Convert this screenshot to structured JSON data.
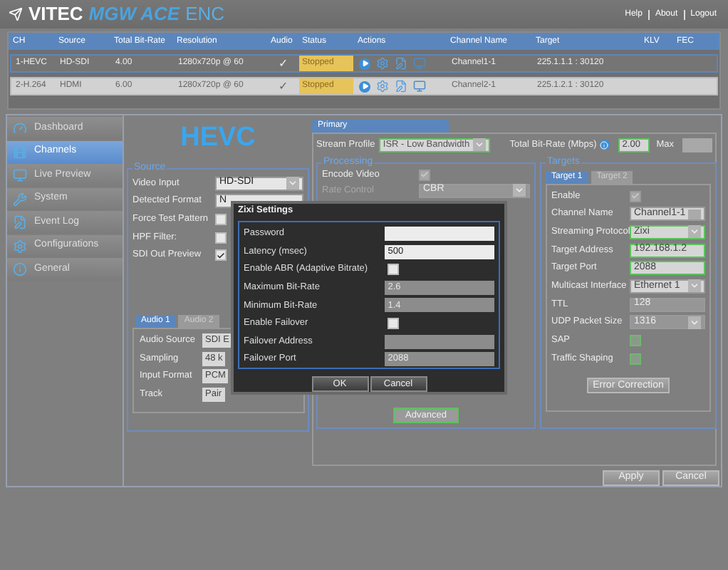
{
  "header": {
    "brand": "VITEC",
    "product": "MGW ACE",
    "suffix": "ENC",
    "links": [
      "Help",
      "About",
      "Logout"
    ]
  },
  "table": {
    "columns": [
      "CH",
      "Source",
      "Total Bit-Rate",
      "Resolution",
      "Audio",
      "Status",
      "Actions",
      "Channel Name",
      "Target",
      "KLV",
      "FEC"
    ],
    "rows": [
      {
        "selected": true,
        "ch": "1-HEVC",
        "source": "HD-SDI",
        "bitrate": "4.00",
        "resolution": "1280x720p @ 60",
        "audio": "✓",
        "status": "Stopped",
        "channel_name": "Channel1-1",
        "target": "225.1.1.1 : 30120"
      },
      {
        "selected": false,
        "ch": "2-H.264",
        "source": "HDMI",
        "bitrate": "6.00",
        "resolution": "1280x720p @ 60",
        "audio": "✓",
        "status": "Stopped",
        "channel_name": "Channel2-1",
        "target": "225.1.2.1 : 30120"
      }
    ]
  },
  "sidebar": {
    "items": [
      {
        "label": "Dashboard",
        "selected": false
      },
      {
        "label": "Channels",
        "selected": true
      },
      {
        "label": "Live Preview",
        "selected": false
      },
      {
        "label": "System",
        "selected": false
      },
      {
        "label": "Event Log",
        "selected": false
      },
      {
        "label": "Configurations",
        "selected": false
      },
      {
        "label": "General",
        "selected": false
      }
    ]
  },
  "page_title": "HEVC",
  "source": {
    "legend": "Source",
    "fields": [
      {
        "label": "Video Input",
        "kind": "select",
        "value": "HD-SDI"
      },
      {
        "label": "Detected Format",
        "kind": "text",
        "value": "N"
      },
      {
        "label": "Force Test Pattern",
        "kind": "checkbox",
        "checked": false
      },
      {
        "label": "HPF Filter:",
        "kind": "checkbox",
        "checked": false
      },
      {
        "label": "SDI Out Preview",
        "kind": "checkbox",
        "checked": true
      }
    ],
    "audio_tabs": [
      {
        "label": "Audio 1",
        "selected": true
      },
      {
        "label": "Audio 2",
        "selected": false
      }
    ],
    "audio_fields": [
      {
        "label": "Audio Source",
        "value": "SDI E"
      },
      {
        "label": "Sampling",
        "value": "48 k"
      },
      {
        "label": "Input Format",
        "value": "PCM"
      },
      {
        "label": "Track",
        "value": "Pair"
      }
    ]
  },
  "primary": {
    "tab": "Primary",
    "stream_profile": {
      "label": "Stream Profile",
      "value": "ISR - Low Bandwidth"
    },
    "total_bitrate": {
      "label": "Total Bit-Rate (Mbps)",
      "value": "2.00"
    },
    "max_label": "Max",
    "processing": {
      "legend": "Processing",
      "fields": [
        {
          "label": "Encode Video",
          "kind": "checkbox",
          "checked": true,
          "disabled": true
        },
        {
          "label": "Rate Control",
          "kind": "select",
          "value": "CBR",
          "disabled": true
        }
      ],
      "advanced_button": "Advanced"
    },
    "targets": {
      "legend": "Targets",
      "tabs": [
        {
          "label": "Target 1",
          "selected": true
        },
        {
          "label": "Target 2",
          "selected": false
        }
      ],
      "fields": [
        {
          "label": "Enable",
          "kind": "checkbox",
          "checked": true,
          "disabled": true,
          "highlighted": false
        },
        {
          "label": "Channel Name",
          "kind": "text-button",
          "value": "Channel1-1",
          "disabled": false,
          "highlighted": false
        },
        {
          "label": "Streaming Protocol",
          "kind": "select",
          "value": "Zixi",
          "disabled": false,
          "highlighted": true
        },
        {
          "label": "Target Address",
          "kind": "text",
          "value": "192.168.1.2",
          "disabled": false,
          "highlighted": true
        },
        {
          "label": "Target Port",
          "kind": "text",
          "value": "2088",
          "disabled": false,
          "highlighted": true
        },
        {
          "label": "Multicast Interface",
          "kind": "select",
          "value": "Ethernet 1",
          "disabled": false,
          "highlighted": false
        },
        {
          "label": "TTL",
          "kind": "text",
          "value": "128",
          "disabled": true,
          "highlighted": false
        },
        {
          "label": "UDP Packet Size",
          "kind": "select",
          "value": "1316",
          "disabled": true,
          "highlighted": false
        },
        {
          "label": "SAP",
          "kind": "checkbox",
          "checked": false,
          "disabled": false,
          "highlighted": true
        },
        {
          "label": "Traffic Shaping",
          "kind": "checkbox",
          "checked": false,
          "disabled": false,
          "highlighted": true
        }
      ],
      "button": "Error Correction"
    }
  },
  "footer_buttons": [
    "Apply",
    "Cancel"
  ],
  "dialog": {
    "title": "Zixi Settings",
    "fields": [
      {
        "label": "Password",
        "kind": "text",
        "disabled": false
      },
      {
        "label": "Latency (msec)",
        "kind": "text",
        "value": "500",
        "disabled": false
      },
      {
        "label": "Enable ABR (Adaptive Bitrate)",
        "kind": "checkbox",
        "checked": false,
        "disabled": false
      },
      {
        "label": "Maximum Bit-Rate",
        "kind": "text",
        "value": "2.6",
        "disabled": true
      },
      {
        "label": "Minimum Bit-Rate",
        "kind": "text",
        "value": "1.4",
        "disabled": true
      },
      {
        "label": "Enable Failover",
        "kind": "checkbox",
        "checked": false,
        "disabled": false
      },
      {
        "label": "Failover Address",
        "kind": "text",
        "disabled": true
      },
      {
        "label": "Failover Port",
        "kind": "text",
        "value": "2088",
        "disabled": true
      }
    ],
    "buttons": [
      "OK",
      "Cancel"
    ]
  }
}
